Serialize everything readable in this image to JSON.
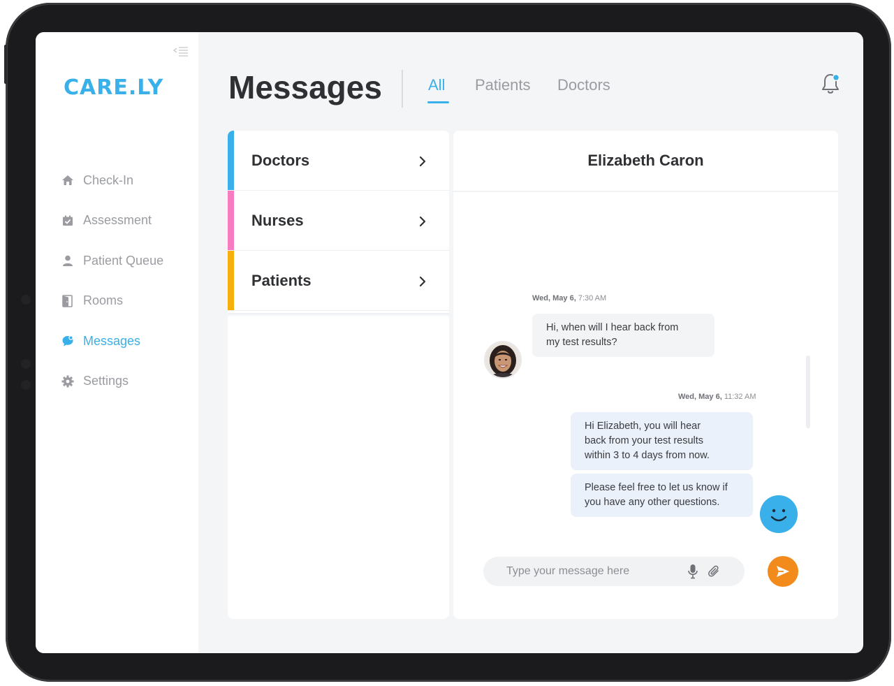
{
  "brand": {
    "logo": "CARE.LY"
  },
  "nav": {
    "items": [
      {
        "label": "Check-In",
        "icon": "home-icon"
      },
      {
        "label": "Assessment",
        "icon": "calendar-check-icon"
      },
      {
        "label": "Patient Queue",
        "icon": "user-icon"
      },
      {
        "label": "Rooms",
        "icon": "door-icon"
      },
      {
        "label": "Messages",
        "icon": "chat-icon",
        "active": true
      },
      {
        "label": "Settings",
        "icon": "gear-icon"
      }
    ]
  },
  "header": {
    "title": "Messages",
    "tabs": [
      {
        "label": "All",
        "active": true
      },
      {
        "label": "Patients"
      },
      {
        "label": "Doctors"
      }
    ]
  },
  "groups": [
    {
      "label": "Doctors",
      "color": "#3ab0ea"
    },
    {
      "label": "Nurses",
      "color": "#f77bc1"
    },
    {
      "label": "Patients",
      "color": "#f6b00c"
    }
  ],
  "chat": {
    "contact_name": "Elizabeth Caron",
    "messages": [
      {
        "day": "Wed, May 6,",
        "time": "7:30 AM",
        "lines": [
          "Hi, when will I hear back from",
          "my test results?"
        ]
      },
      {
        "day": "Wed, May 6,",
        "time": "11:32 AM",
        "lines": [
          "Hi Elizabeth, you will hear",
          "back from your test results",
          "within 3 to 4 days from now."
        ]
      },
      {
        "lines": [
          "Please feel free to let us know if",
          "you have any other questions."
        ]
      }
    ],
    "input_placeholder": "Type your message here"
  },
  "colors": {
    "accent": "#3ab0ea",
    "send": "#f28a1c",
    "text": "#2f3033",
    "muted": "#9a9ca2"
  }
}
